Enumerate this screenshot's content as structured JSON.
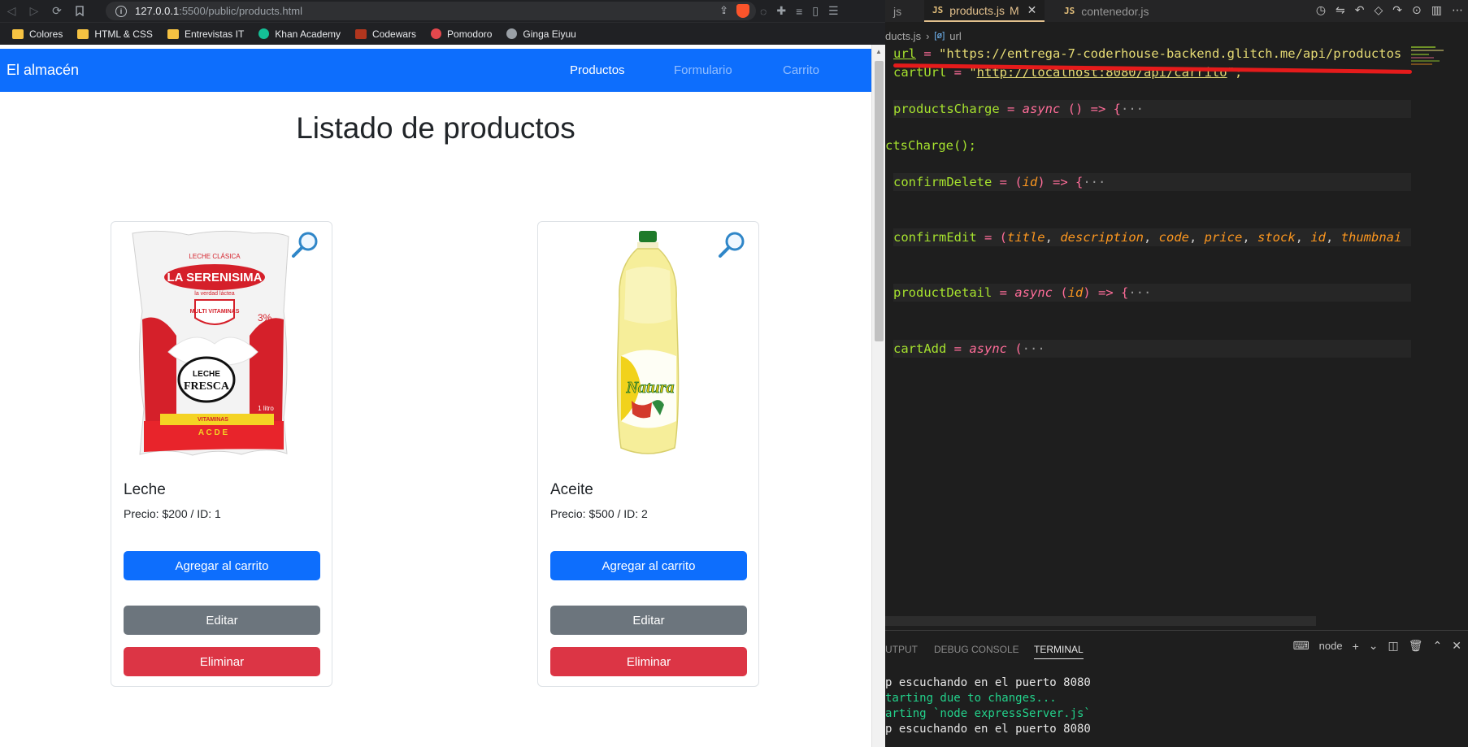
{
  "browser": {
    "url_host": "127.0.0.1",
    "url_rest": ":5500/public/products.html",
    "bookmarks": [
      {
        "label": "Colores",
        "icon": "folder-icon"
      },
      {
        "label": "HTML & CSS",
        "icon": "folder-icon"
      },
      {
        "label": "Entrevistas IT",
        "icon": "folder-icon"
      },
      {
        "label": "Khan Academy",
        "icon": "khan-academy-icon"
      },
      {
        "label": "Codewars",
        "icon": "codewars-icon"
      },
      {
        "label": "Pomodoro",
        "icon": "pomodoro-icon"
      },
      {
        "label": "Ginga Eiyuu",
        "icon": "globe-icon"
      }
    ]
  },
  "page": {
    "brand": "El almacén",
    "nav": [
      "Productos",
      "Formulario",
      "Carrito"
    ],
    "heading": "Listado de productos",
    "products": [
      {
        "title": "Leche",
        "price": "Precio: $200 / ID: 1",
        "add": "Agregar al carrito",
        "edit": "Editar",
        "delete": "Eliminar"
      },
      {
        "title": "Aceite",
        "price": "Precio: $500 / ID: 2",
        "add": "Agregar al carrito",
        "edit": "Editar",
        "delete": "Eliminar"
      }
    ],
    "milk_package": {
      "top": "LECHE CLÁSICA",
      "brand": "LA SERENISIMA",
      "slogan": "la verdad láctea",
      "badge": "MULTI VITAMINAS",
      "fat": "3%",
      "center1": "LECHE",
      "center2": "FRESCA",
      "vitamins_label": "VITAMINAS",
      "vitamins": "A C D E",
      "volume": "1 litro"
    },
    "oil_bottle": {
      "brand": "Natura"
    }
  },
  "editor": {
    "tabs": [
      {
        "label": "js"
      },
      {
        "label": "products.js",
        "modified": "M",
        "close": "✕"
      },
      {
        "label": "contenedor.js"
      }
    ],
    "breadcrumb_file": "ducts.js",
    "breadcrumb_symbol": "url",
    "code": {
      "l1_name": "url",
      "l1_eq": " = ",
      "l1_str": "\"https://entrega-7-coderhouse-backend.glitch.me/api/productos",
      "l2_name": "cartUrl",
      "l2_eq": " = ",
      "l2_str_q": "\"",
      "l2_str": "http://localhost:8080/api/carrito",
      "l2_end": "\";",
      "l3_name": "productsCharge",
      "l3_rest_kw": "async",
      "l3_tail": " () => {",
      "l4": "ctsCharge();",
      "l5_name": "confirmDelete",
      "l5_param": "id",
      "l6_name": "confirmEdit",
      "l6_params": [
        "title",
        "description",
        "code",
        "price",
        "stock",
        "id",
        "thumbnai"
      ],
      "l7_name": "productDetail",
      "l7_param": "id",
      "l8_name": "cartAdd",
      "ellipsis": "···"
    },
    "panel": {
      "tabs": [
        "UTPUT",
        "DEBUG CONSOLE",
        "TERMINAL"
      ],
      "shell": "node",
      "terminal": [
        {
          "text": "p escuchando en el puerto 8080",
          "color": "white"
        },
        {
          "text": "tarting due to changes...",
          "color": "green"
        },
        {
          "text": "arting `node expressServer.js`",
          "color": "green"
        },
        {
          "text": "p escuchando en el puerto 8080",
          "color": "white"
        }
      ]
    }
  }
}
